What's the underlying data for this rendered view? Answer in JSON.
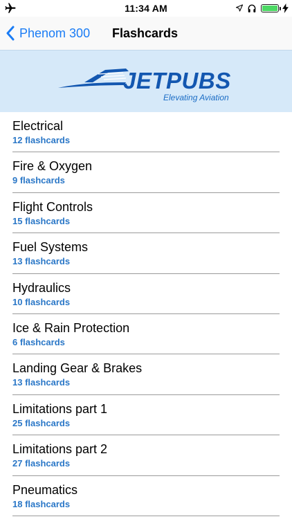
{
  "status_bar": {
    "time": "11:34 AM",
    "left_icon": "airplane-icon",
    "right_icons": [
      "location-arrow-icon",
      "headphones-icon",
      "battery-icon",
      "charging-bolt-icon"
    ],
    "battery_level": 1.0,
    "battery_color": "#4cd964"
  },
  "nav": {
    "back_label": "Phenom 300",
    "title": "Flashcards",
    "accent_color": "#1a7cf5"
  },
  "banner": {
    "brand": "JETPUBS",
    "tagline": "Elevating Aviation",
    "brand_color": "#1357b0",
    "background": "#d6e9f9"
  },
  "list": {
    "count_color": "#2a77c7",
    "items": [
      {
        "title": "Electrical",
        "count": "12 flashcards"
      },
      {
        "title": "Fire & Oxygen",
        "count": "9 flashcards"
      },
      {
        "title": "Flight Controls",
        "count": "15 flashcards"
      },
      {
        "title": "Fuel Systems",
        "count": "13 flashcards"
      },
      {
        "title": "Hydraulics",
        "count": "10 flashcards"
      },
      {
        "title": "Ice & Rain Protection",
        "count": "6 flashcards"
      },
      {
        "title": "Landing Gear & Brakes",
        "count": "13 flashcards"
      },
      {
        "title": "Limitations part 1",
        "count": "25 flashcards"
      },
      {
        "title": "Limitations part 2",
        "count": "27 flashcards"
      },
      {
        "title": "Pneumatics",
        "count": "18 flashcards"
      }
    ]
  }
}
